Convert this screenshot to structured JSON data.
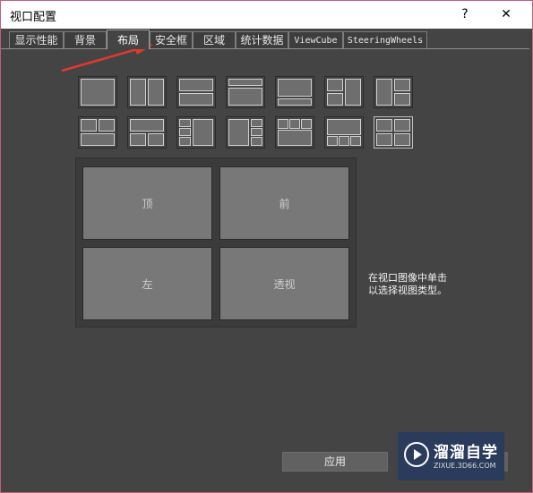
{
  "window": {
    "title": "视口配置",
    "help_label": "?",
    "close_label": "✕",
    "accent": "#c0607c"
  },
  "tabs": [
    {
      "label": "显示性能",
      "active": false
    },
    {
      "label": "背景",
      "active": false
    },
    {
      "label": "布局",
      "active": true
    },
    {
      "label": "安全框",
      "active": false
    },
    {
      "label": "区域",
      "active": false
    },
    {
      "label": "统计数据",
      "active": false
    },
    {
      "label": "ViewCube",
      "active": false
    },
    {
      "label": "SteeringWheels",
      "active": false
    }
  ],
  "annotation": {
    "arrow_color": "#e03a2e"
  },
  "layouts": {
    "count": 14,
    "selected_index": 13
  },
  "preview": {
    "viewports": [
      "顶",
      "前",
      "左",
      "透视"
    ]
  },
  "hint": {
    "line1": "在视口图像中单击",
    "line2": "以选择视图类型。"
  },
  "footer": {
    "apply_label": "应用"
  },
  "watermark": {
    "name": "溜溜自学",
    "url": "ZIXUE.3D66.COM",
    "bg": "#2b3b5c"
  }
}
